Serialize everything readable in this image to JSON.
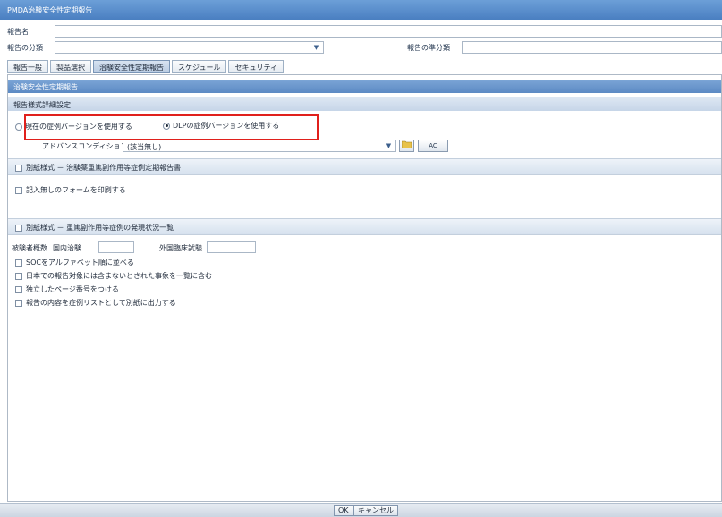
{
  "window": {
    "title": "PMDA治験安全性定期報告"
  },
  "header": {
    "report_name_label": "報告名",
    "report_name_value": "",
    "report_category_label": "報告の分類",
    "report_category_value": "",
    "report_subcategory_label": "報告の準分類",
    "report_subcategory_value": ""
  },
  "tabs": [
    {
      "label": "報告一般"
    },
    {
      "label": "製品選択"
    },
    {
      "label": "治験安全性定期報告"
    },
    {
      "label": "スケジュール"
    },
    {
      "label": "セキュリティ"
    }
  ],
  "panel": {
    "title": "治験安全性定期報告",
    "format_settings_header": "報告様式詳細設定",
    "radio_current": "現在の症例バージョンを使用する",
    "radio_dlp": "DLPの症例バージョンを使用する",
    "advanced_condition_label": "アドバンスコンディション",
    "advanced_condition_value": "(該当無し)",
    "ac_button": "AC",
    "section1_title": "別紙様式 － 治験薬重篤副作用等症例定期報告書",
    "section1_checkbox": "記入無しのフォームを印刷する",
    "section2_title": "別紙様式 － 重篤副作用等症例の発現状況一覧",
    "subjects_label": "被験者概数",
    "domestic_label": "国内治験",
    "foreign_label": "外国臨床試験",
    "options": [
      "SOCをアルファベット順に並べる",
      "日本での報告対象には含まないとされた事象を一覧に含む",
      "独立したページ番号をつける",
      "報告の内容を症例リストとして別紙に出力する"
    ]
  },
  "footer": {
    "ok_label": "OK",
    "cancel_label": "キャンセル"
  }
}
